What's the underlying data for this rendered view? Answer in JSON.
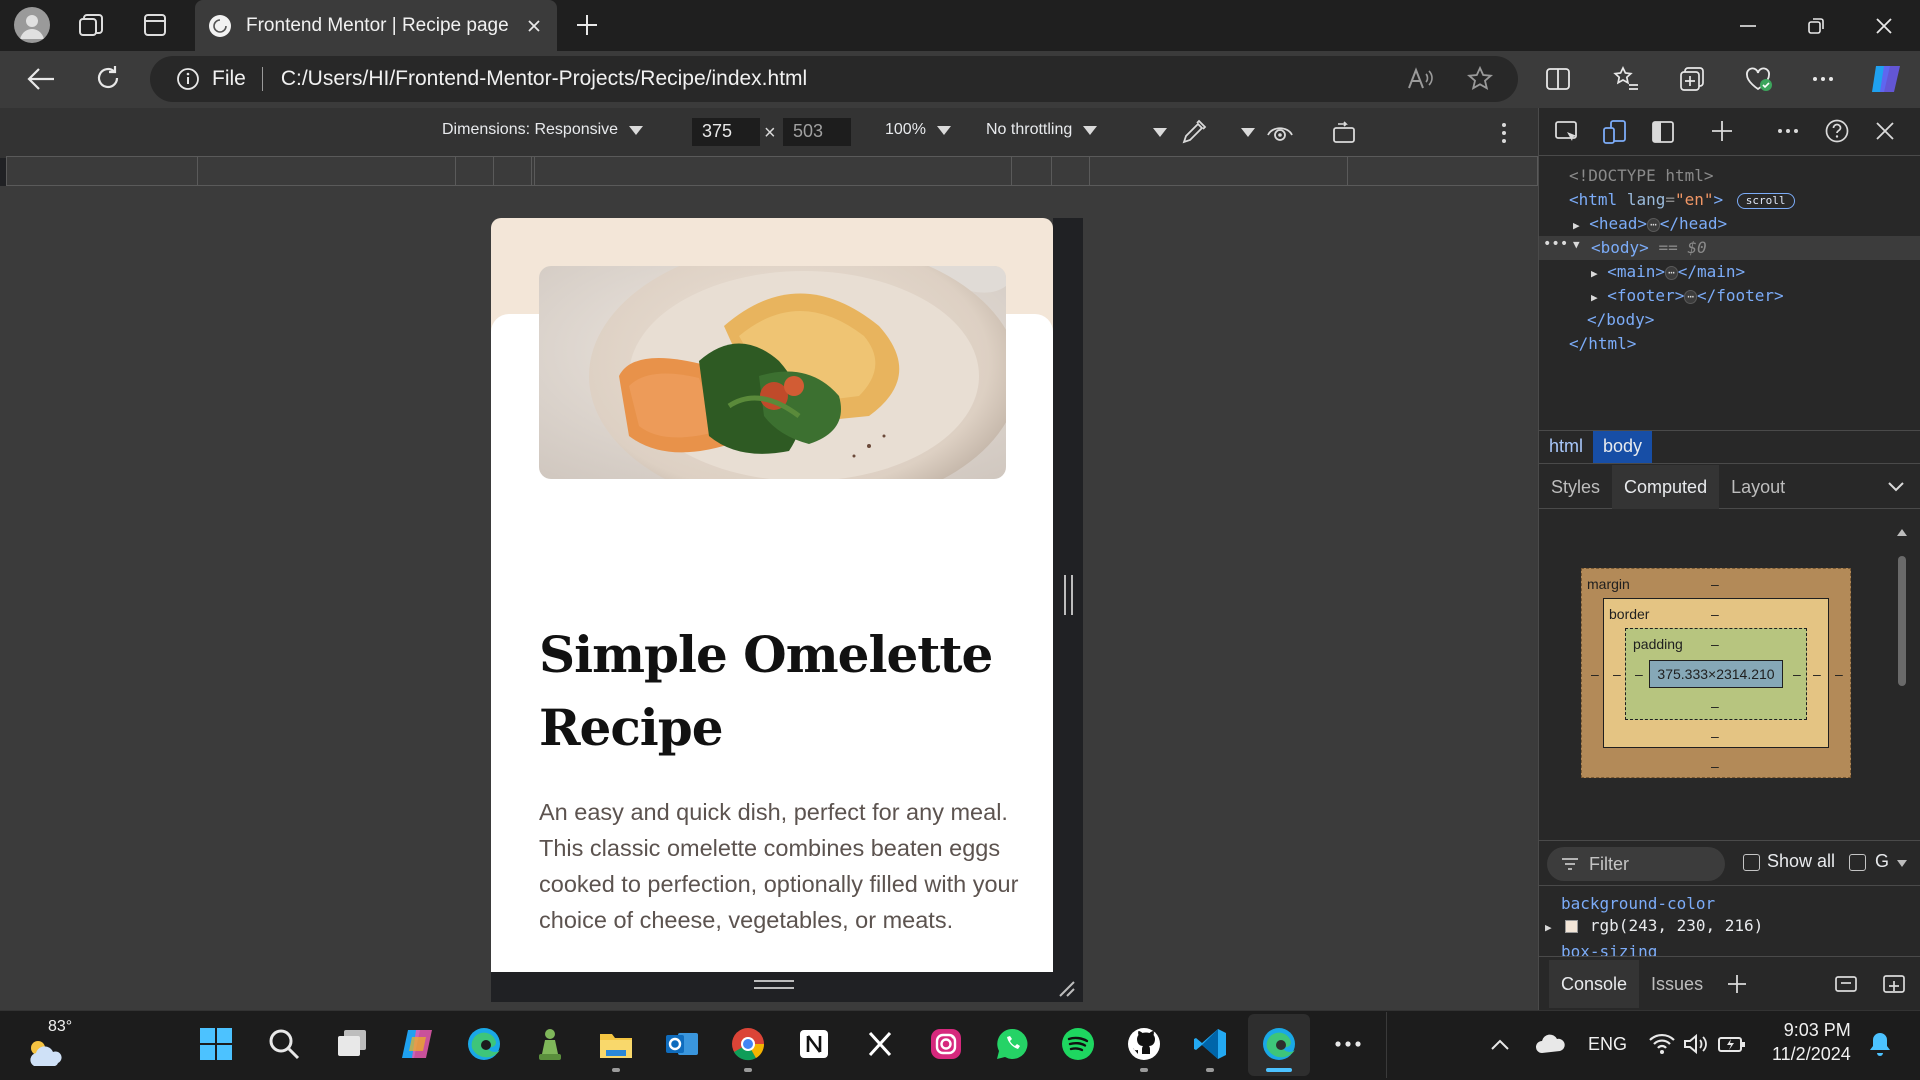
{
  "browser": {
    "tab_title": "Frontend Mentor | Recipe page",
    "address_scheme": "File",
    "address_url": "C:/Users/HI/Frontend-Mentor-Projects/Recipe/index.html"
  },
  "device_toolbar": {
    "dimensions_label": "Dimensions: Responsive",
    "width": "375",
    "times": "×",
    "height": "503",
    "zoom": "100%",
    "throttling": "No throttling"
  },
  "page": {
    "title": "Simple Omelette Recipe",
    "description": "An easy and quick dish, perfect for any meal. This classic omelette combines beaten eggs cooked to perfection, optionally filled with your choice of cheese, vegetables, or meats."
  },
  "devtools": {
    "elements": {
      "doctype": "<!DOCTYPE html>",
      "html_open": "<html",
      "lang_attr": "lang",
      "lang_val": "\"en\"",
      "scroll_badge": "scroll",
      "head_open": "<head>",
      "head_close": "</head>",
      "body_open": "<body>",
      "body_ref": "== $0",
      "main_open": "<main>",
      "main_close": "</main>",
      "footer_open": "<footer>",
      "footer_close": "</footer>",
      "body_close": "</body>",
      "html_close": "</html>",
      "ellipsis": "⋯"
    },
    "breadcrumbs": [
      "html",
      "body"
    ],
    "subtabs": [
      "Styles",
      "Computed",
      "Layout"
    ],
    "box_model": {
      "margin": "margin",
      "border": "border",
      "padding": "padding",
      "dash": "–",
      "content": "375.333×2314.210"
    },
    "filter_placeholder": "Filter",
    "show_all": "Show all",
    "group_label": "Gr",
    "props": [
      {
        "name": "background-color",
        "value": "rgb(243, 230, 216)"
      },
      {
        "name": "box-sizing",
        "value": ""
      }
    ],
    "drawer_tabs": [
      "Console",
      "Issues"
    ]
  },
  "taskbar": {
    "weather_temp": "83°",
    "language": "ENG",
    "time": "9:03 PM",
    "date": "11/2/2024"
  },
  "colors": {
    "page_bg": "#f3e6d8",
    "card_bg": "#ffffff",
    "devtools_accent": "#7cacf8"
  }
}
